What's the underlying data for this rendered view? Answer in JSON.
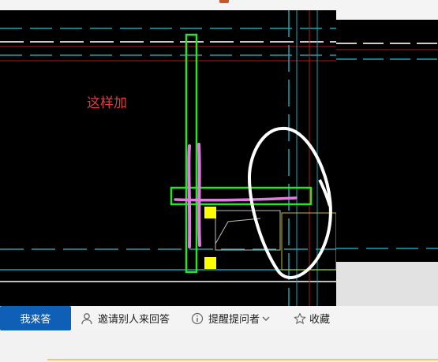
{
  "cad": {
    "annotation_text": "这样加"
  },
  "actions": {
    "answer_label": "我来答",
    "invite_label": "邀请别人来回答",
    "remind_label": "提醒提问者",
    "favorite_label": "收藏"
  }
}
